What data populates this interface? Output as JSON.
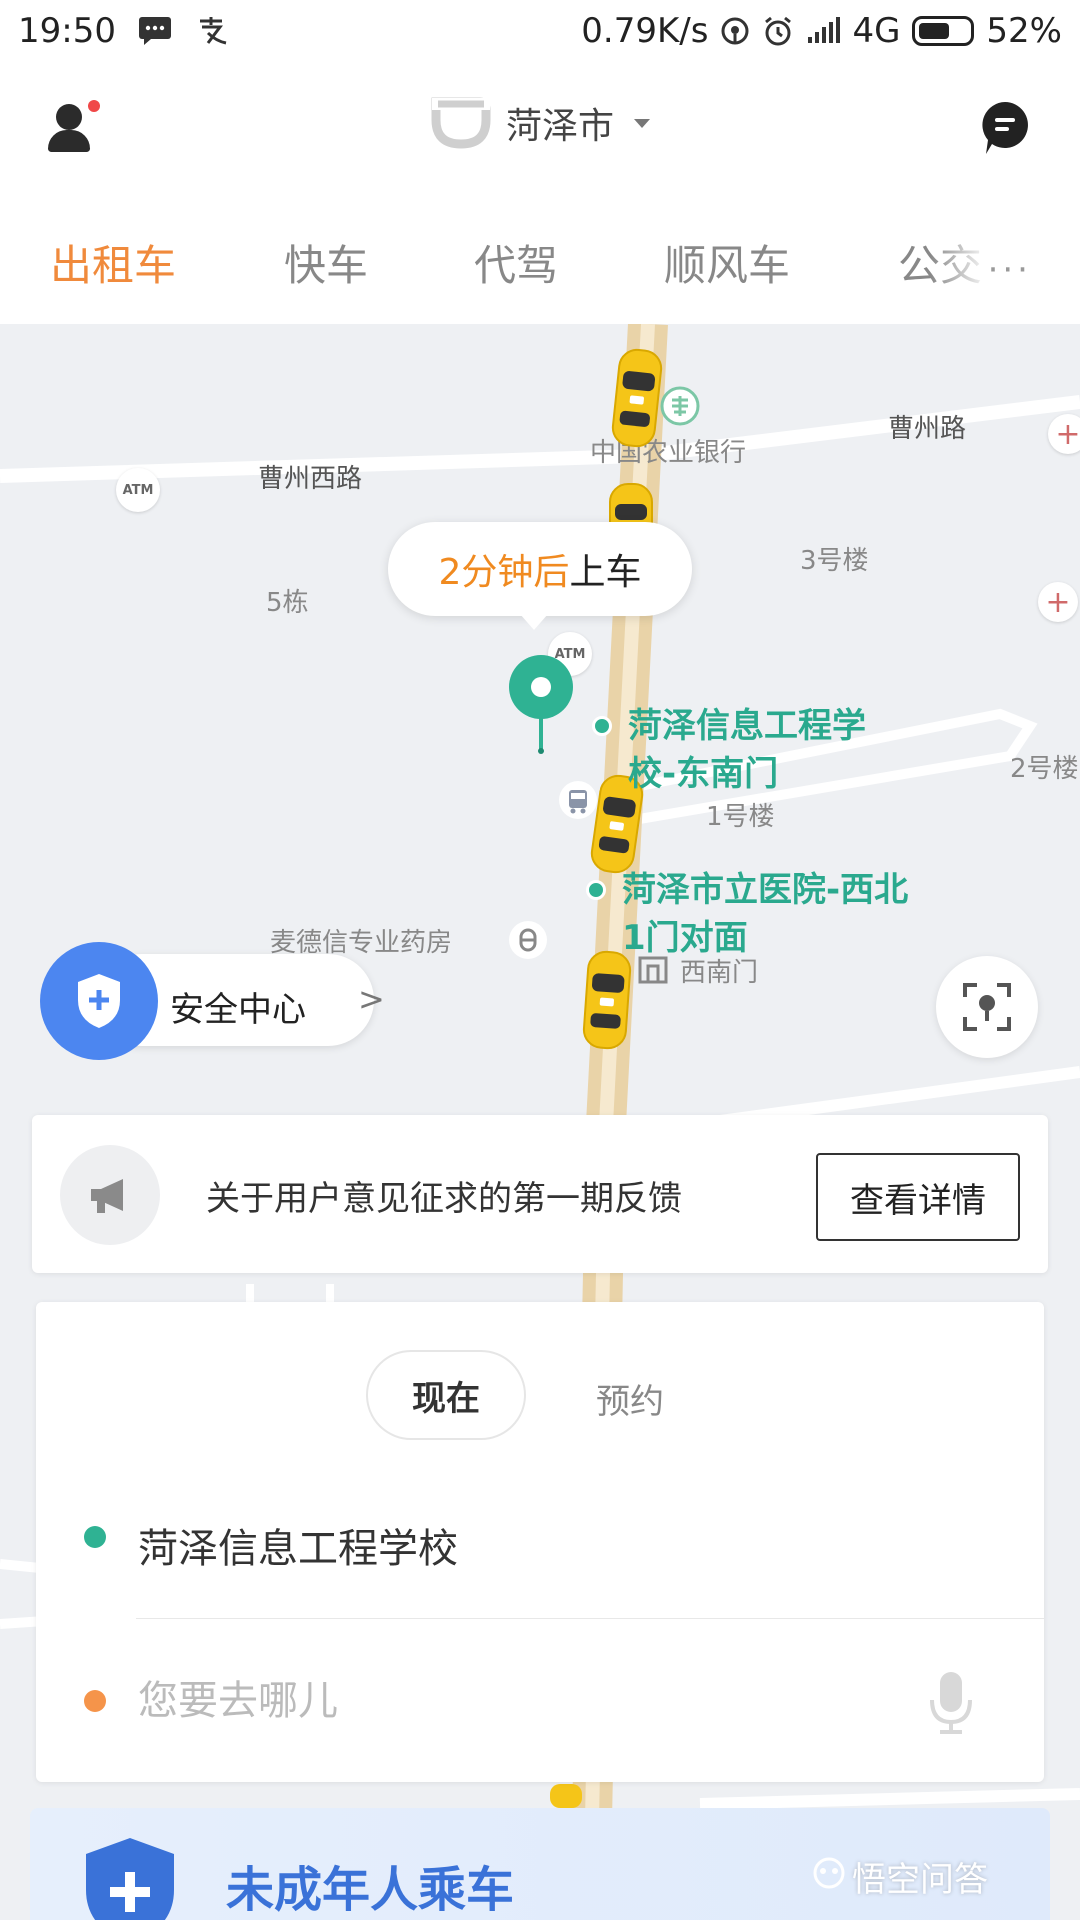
{
  "status_bar": {
    "time": "19:50",
    "network_speed": "0.79K/s",
    "network_type": "4G",
    "battery": "52%",
    "icons": [
      "message-icon",
      "alipay-icon",
      "hotspot-icon",
      "alarm-icon",
      "signal-icon",
      "battery-icon"
    ]
  },
  "header": {
    "city": "菏泽市",
    "icons": [
      "profile-icon",
      "didi-logo-icon",
      "message-bubble-icon"
    ]
  },
  "tabs": [
    {
      "label": "出租车",
      "active": true
    },
    {
      "label": "快车",
      "active": false
    },
    {
      "label": "代驾",
      "active": false
    },
    {
      "label": "顺风车",
      "active": false
    },
    {
      "label": "公交",
      "active": false
    }
  ],
  "tabs_more": "···",
  "map": {
    "eta_prefix": "2分钟后",
    "eta_suffix": "上车",
    "labels": {
      "road_caozhou": "曹州路",
      "road_caozhou_west": "曹州西路",
      "bank": "中国农业银行",
      "bldg_3": "3号楼",
      "bldg_5": "5栋",
      "bldg_2": "2号楼",
      "bldg_1": "1号楼",
      "pharmacy": "麦德信专业药房",
      "west_gate": "西南门",
      "atm": "ATM"
    },
    "pickup_points": [
      {
        "line1": "菏泽信息工程学",
        "line2": "校-东南门"
      },
      {
        "line1": "菏泽市立医院-西北",
        "line2": "1门对面"
      }
    ],
    "colors": {
      "taxi": "#f5c518",
      "teal": "#2fb293",
      "road": "#e9d3a8"
    }
  },
  "safety": {
    "label": "安全中心"
  },
  "notice": {
    "text": "关于用户意见征求的第一期反馈",
    "button": "查看详情"
  },
  "order": {
    "time_now": "现在",
    "time_later": "预约",
    "from": "菏泽信息工程学校",
    "to_placeholder": "您要去哪儿"
  },
  "banner": {
    "title": "未成年人乘车"
  },
  "watermark": "悟空问答",
  "accent_color": "#f08a3c"
}
